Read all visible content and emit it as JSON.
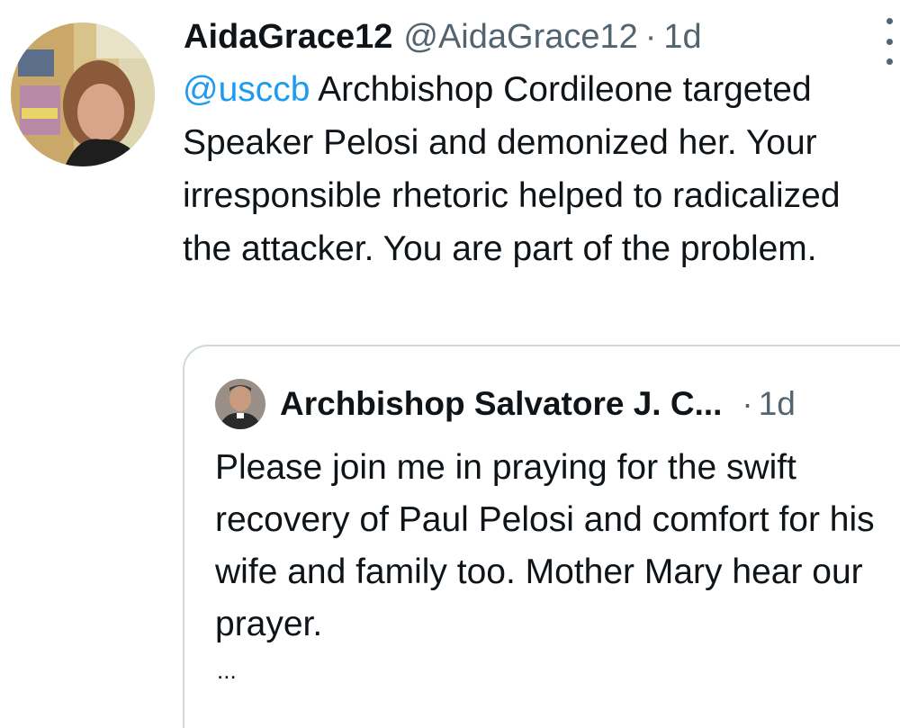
{
  "tweet": {
    "display_name": "AidaGrace12",
    "handle": "@AidaGrace12",
    "separator": "·",
    "time": "1d",
    "mention": "@usccb",
    "text": " Archbishop Cordileone targeted Speaker Pelosi and demonized her. Your irresponsible rhetoric helped to radicalized the attacker. You are part of the problem.",
    "more_icon": "vertical-ellipsis-icon"
  },
  "quoted_tweet": {
    "display_name": "Archbishop Salvatore J. C...",
    "separator": "·",
    "time": "1d",
    "text": "Please join me in praying for the swift recovery of Paul Pelosi and comfort for his wife and family too. Mother Mary hear our prayer.",
    "ellipsis": "..."
  },
  "colors": {
    "link": "#1d9bf0",
    "secondary_text": "#536471",
    "primary_text": "#0f1419",
    "border": "#cfd9de"
  }
}
